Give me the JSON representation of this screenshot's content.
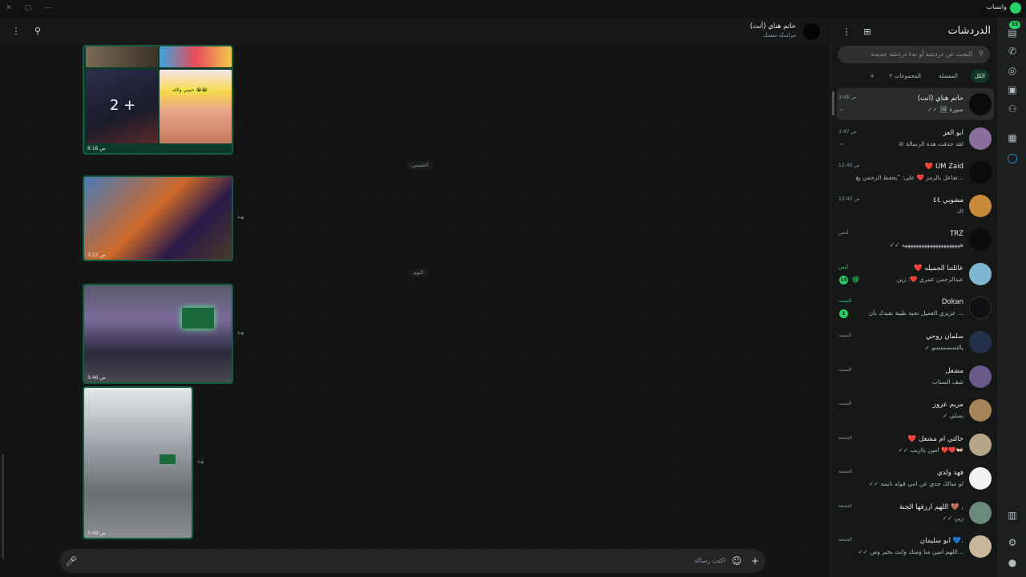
{
  "app": {
    "title": "واتساب",
    "logo_icon": "whatsapp-logo-icon",
    "accent": "#25d366"
  },
  "window": {
    "minimize": "—",
    "maximize": "▢",
    "close": "✕"
  },
  "rail": {
    "badge": "15"
  },
  "chats_panel": {
    "title": "الدردشات",
    "search_placeholder": "البحث عن دردشة أو بدء دردشة جديدة",
    "filters": {
      "all": "الكل",
      "favorites": "المفضلة",
      "groups": "المجموعات ٢",
      "add": "+"
    }
  },
  "chats": [
    {
      "name": "حاتم هناي (أنت)",
      "preview": "✓✓ 🖼 صورة",
      "time": "3:49 ص",
      "chevron": "⌄"
    },
    {
      "name": "ابو العز",
      "preview": "⊘ لقد حذفت هذه الرسالة",
      "time": "3:47 ص",
      "chevron": "⌄"
    },
    {
      "name": "❤️ UM Zaid",
      "preview": "تفاعل بالرمز ❤️ على: \"يحفظ الرحمن يغ...",
      "time": "12:40 ص"
    },
    {
      "name": "مشوبي ٤٤",
      "preview": "اك",
      "time": "12:40 ص"
    },
    {
      "name": "TRZ",
      "preview": "✓✓ هههههههههههههههههههههه",
      "time": "أمس"
    },
    {
      "name": "❤️ عائلتنا الجميله",
      "preview": "عبدالرحمن عمري ❤️: زين",
      "time": "أمس",
      "badge": "15",
      "mention": "@"
    },
    {
      "name": "Dokan",
      "preview": "عزيزي العميل تحية طيبة نفيدك بأن ...",
      "time": "السبت",
      "badge": "1"
    },
    {
      "name": "سلمان روحي",
      "preview": "✓ يالتسسسسو",
      "time": "السبت"
    },
    {
      "name": "مشعل",
      "preview": "شف الستاب",
      "time": "السبت"
    },
    {
      "name": "مريم عزوز",
      "preview": "✓ بصلي",
      "time": "السبت"
    },
    {
      "name": "❤️ خالتي ام مشعل",
      "preview": "✓✓ امين يااربب ❤️❤️👐🏻",
      "time": "الجمعة"
    },
    {
      "name": "فهد ولدي",
      "preview": "✓✓ لو سالك جدي عن امي قوله نايمه",
      "time": "الجمعة"
    },
    {
      "name": "اللهم أرزقها الجنة 🤎 .",
      "preview": "✓✓ زين",
      "time": "الجمعة"
    },
    {
      "name": "ابو سليمان 💙.",
      "preview": "✓✓ اللهم امين منا ومنك وانت بخير وص...",
      "time": "الجمعة"
    }
  ],
  "conversation": {
    "title": "حاتم هناي (أنت)",
    "subtitle": "مراسلة نفسك",
    "date_thursday": "الخميس",
    "date_today": "اليوم",
    "more_count": "2 +",
    "tile_caption": "حبيبي والله 😭😭",
    "msg_times": [
      "6:16 ص",
      "3:52 ص",
      "3:46 ص",
      "3:49 ص"
    ],
    "composer_placeholder": "اكتب رسالة"
  }
}
